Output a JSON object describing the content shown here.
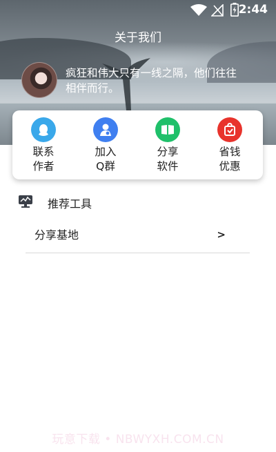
{
  "status_bar": {
    "time": "2:44"
  },
  "header": {
    "title": "关于我们",
    "bio": "疯狂和伟大只有一线之隔，他们往往相伴而行。"
  },
  "actions": [
    {
      "label_line1": "联系",
      "label_line2": "作者",
      "icon": "contact-author-icon",
      "color": "#3aa8ea"
    },
    {
      "label_line1": "加入",
      "label_line2": "Q群",
      "icon": "join-qq-group-icon",
      "color": "#3f7ff0"
    },
    {
      "label_line1": "分享",
      "label_line2": "软件",
      "icon": "share-software-icon",
      "color": "#1fc06a"
    },
    {
      "label_line1": "省钱",
      "label_line2": "优惠",
      "icon": "save-money-icon",
      "color": "#e8332c"
    }
  ],
  "section": {
    "title": "推荐工具",
    "items": [
      {
        "label": "分享基地",
        "arrow": ">"
      }
    ]
  },
  "watermark": "玩意下载 • NBWYXH.COM.CN"
}
